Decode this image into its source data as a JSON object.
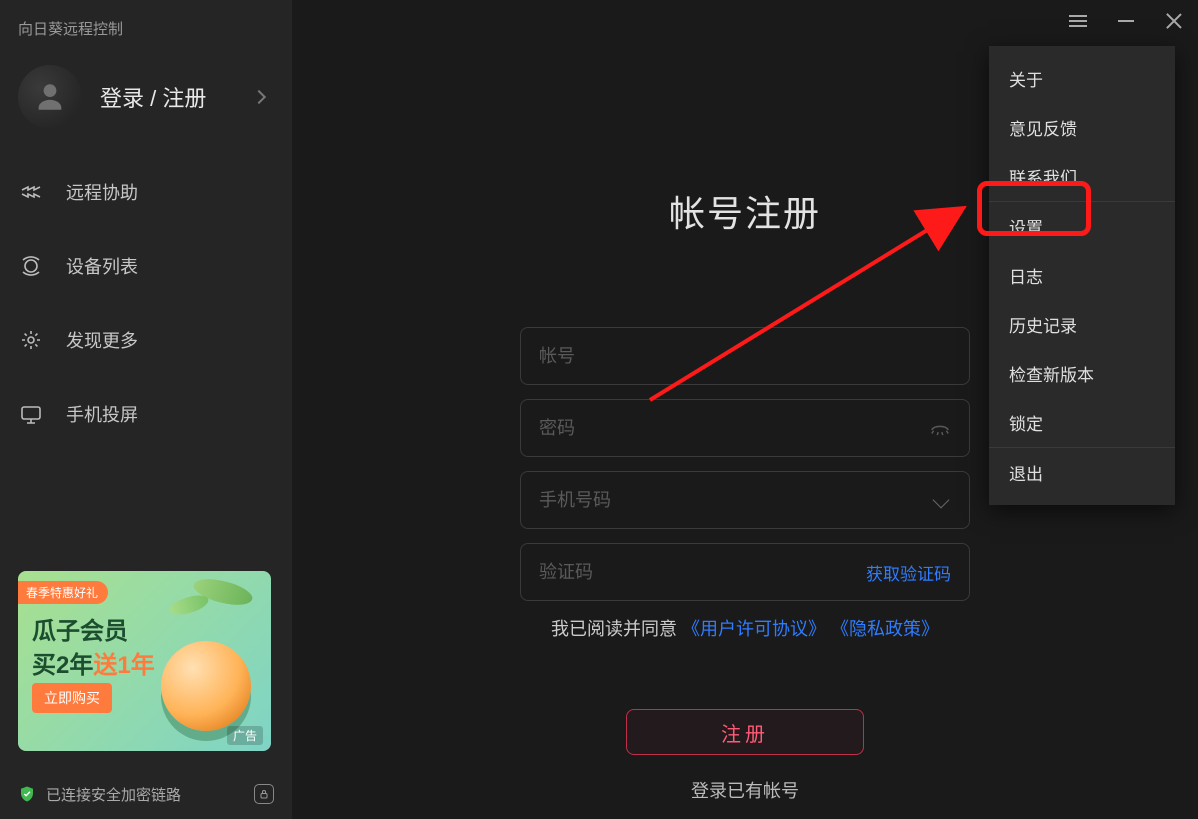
{
  "app_title": "向日葵远程控制",
  "login_register": "登录 / 注册",
  "sidebar": {
    "items": [
      {
        "label": "远程协助"
      },
      {
        "label": "设备列表"
      },
      {
        "label": "发现更多"
      },
      {
        "label": "手机投屏"
      }
    ]
  },
  "promo": {
    "tag": "春季特惠好礼",
    "line1": "瓜子会员",
    "line2_a": "买2年",
    "line2_b": "送1年",
    "btn": "立即购买",
    "ad_label": "广告"
  },
  "status": "已连接安全加密链路",
  "page_title": "帐号注册",
  "fields": {
    "account_ph": "帐号",
    "password_ph": "密码",
    "phone_ph": "手机号码",
    "code_ph": "验证码",
    "get_code": "获取验证码"
  },
  "agree": {
    "prefix": "我已阅读并同意",
    "link1": "《用户许可协议》",
    "link2": "《隐私政策》"
  },
  "register_label": "注册",
  "login_existing": "登录已有帐号",
  "menu": {
    "about": "关于",
    "feedback": "意见反馈",
    "contact": "联系我们",
    "settings": "设置",
    "log": "日志",
    "history": "历史记录",
    "check_update": "检查新版本",
    "lock": "锁定",
    "exit": "退出"
  }
}
